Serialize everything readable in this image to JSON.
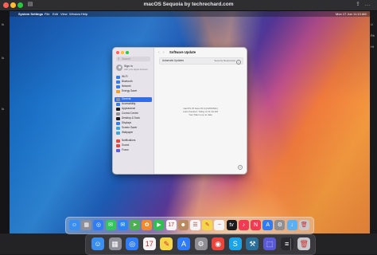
{
  "host": {
    "title": "macOS Sequoia by techrechard.com",
    "left_strip_labels": [
      "Ik",
      "Ik",
      "Ik"
    ],
    "right_strip_labels": [
      "U",
      "Rb",
      "Ht"
    ]
  },
  "menubar": {
    "apple": "",
    "app": "System Settings",
    "items": [
      "File",
      "Edit",
      "View",
      "Window",
      "Help"
    ],
    "clock": "Mon 17 Jun  11:13 AM"
  },
  "settings": {
    "search_placeholder": "Search",
    "account_name": "Sign in",
    "account_sub": "with your Apple Account",
    "nav_back": "‹",
    "nav_forward": "›",
    "title": "Software Update",
    "row_label": "Automatic Updates",
    "row_value": "Security Responses",
    "row_info": "i",
    "status_lines": [
      "macOS 15 beta 15.0 (24A5264n)",
      "Last checked: Today at 11:10 AM",
      "Your Mac is up to date"
    ],
    "help": "?",
    "sidebar": [
      {
        "label": "Wi-Fi",
        "color": "#2f7cf6"
      },
      {
        "label": "Bluetooth",
        "color": "#2f7cf6"
      },
      {
        "label": "Network",
        "color": "#2f7cf6"
      },
      {
        "label": "Energy Saver",
        "color": "#f0a020"
      },
      {
        "label": "General",
        "color": "#8e8e93",
        "selected": true
      },
      {
        "label": "Accessibility",
        "color": "#2f7cf6"
      },
      {
        "label": "Appearance",
        "color": "#1c1c1e"
      },
      {
        "label": "Control Centre",
        "color": "#8e8e93"
      },
      {
        "label": "Desktop & Dock",
        "color": "#1c1c1e"
      },
      {
        "label": "Displays",
        "color": "#2f7cf6"
      },
      {
        "label": "Screen Saver",
        "color": "#39a8e0"
      },
      {
        "label": "Wallpaper",
        "color": "#39a8e0"
      },
      {
        "label": "Notifications",
        "color": "#e8453c"
      },
      {
        "label": "Sound",
        "color": "#e8453c"
      },
      {
        "label": "Focus",
        "color": "#5e5ce6"
      }
    ]
  },
  "dock": {
    "icons": [
      {
        "name": "finder-icon",
        "glyph": "☺",
        "color": "#3a8ef0"
      },
      {
        "name": "launchpad-icon",
        "glyph": "▦",
        "color": "#8f8f9a"
      },
      {
        "name": "safari-icon",
        "glyph": "◎",
        "color": "#2f7cf6"
      },
      {
        "name": "messages-icon",
        "glyph": "✉",
        "color": "#32c75a"
      },
      {
        "name": "mail-icon",
        "glyph": "✉",
        "color": "#2a86f5"
      },
      {
        "name": "maps-icon",
        "glyph": "➤",
        "color": "#4cb050"
      },
      {
        "name": "photos-icon",
        "glyph": "✿",
        "color": "#f08a2a"
      },
      {
        "name": "facetime-icon",
        "glyph": "▶",
        "color": "#2fbf4f"
      },
      {
        "name": "calendar-icon",
        "glyph": "17",
        "color": "#f4f4f4"
      },
      {
        "name": "contacts-icon",
        "glyph": "☻",
        "color": "#b88a60"
      },
      {
        "name": "reminders-icon",
        "glyph": "☰",
        "color": "#f4f4f4"
      },
      {
        "name": "notes-icon",
        "glyph": "✎",
        "color": "#f5d54a"
      },
      {
        "name": "freeform-icon",
        "glyph": "~",
        "color": "#f4f4f4"
      },
      {
        "name": "tv-icon",
        "glyph": "tv",
        "color": "#1c1c1e"
      },
      {
        "name": "music-icon",
        "glyph": "♪",
        "color": "#f23a55"
      },
      {
        "name": "news-icon",
        "glyph": "N",
        "color": "#f23a55"
      },
      {
        "name": "app-store-icon",
        "glyph": "A",
        "color": "#2f7cf6"
      },
      {
        "name": "system-settings-icon",
        "glyph": "⚙",
        "color": "#8e8e93"
      },
      {
        "name": "downloads-folder-icon",
        "glyph": "↓",
        "color": "#5ab0f0"
      },
      {
        "name": "trash-icon",
        "glyph": "🗑",
        "color": "#c8c8cc"
      }
    ]
  },
  "host_dock": {
    "icons": [
      {
        "name": "host-finder-icon",
        "glyph": "☺",
        "color": "#3a8ef0"
      },
      {
        "name": "host-launchpad-icon",
        "glyph": "▦",
        "color": "#8f8f9a"
      },
      {
        "name": "host-safari-icon",
        "glyph": "◎",
        "color": "#2f7cf6"
      },
      {
        "name": "host-calendar-icon",
        "glyph": "17",
        "color": "#f4f4f4"
      },
      {
        "name": "host-notes-icon",
        "glyph": "✎",
        "color": "#f5d54a"
      },
      {
        "name": "host-app-store-icon",
        "glyph": "A",
        "color": "#2f7cf6"
      },
      {
        "name": "host-system-settings-icon",
        "glyph": "⚙",
        "color": "#8e8e93"
      },
      {
        "name": "host-chrome-icon",
        "glyph": "◉",
        "color": "#e8453c"
      },
      {
        "name": "host-skype-icon",
        "glyph": "S",
        "color": "#1aa3e8"
      },
      {
        "name": "host-utilities-icon",
        "glyph": "⚒",
        "color": "#2a6f9a"
      },
      {
        "name": "host-vm-icon",
        "glyph": "⬚",
        "color": "#5a5ad8"
      },
      {
        "name": "host-activity-icon",
        "glyph": "≡",
        "color": "#2a2a2e"
      },
      {
        "name": "host-trash-icon",
        "glyph": "🗑",
        "color": "#c8c8cc"
      }
    ]
  }
}
